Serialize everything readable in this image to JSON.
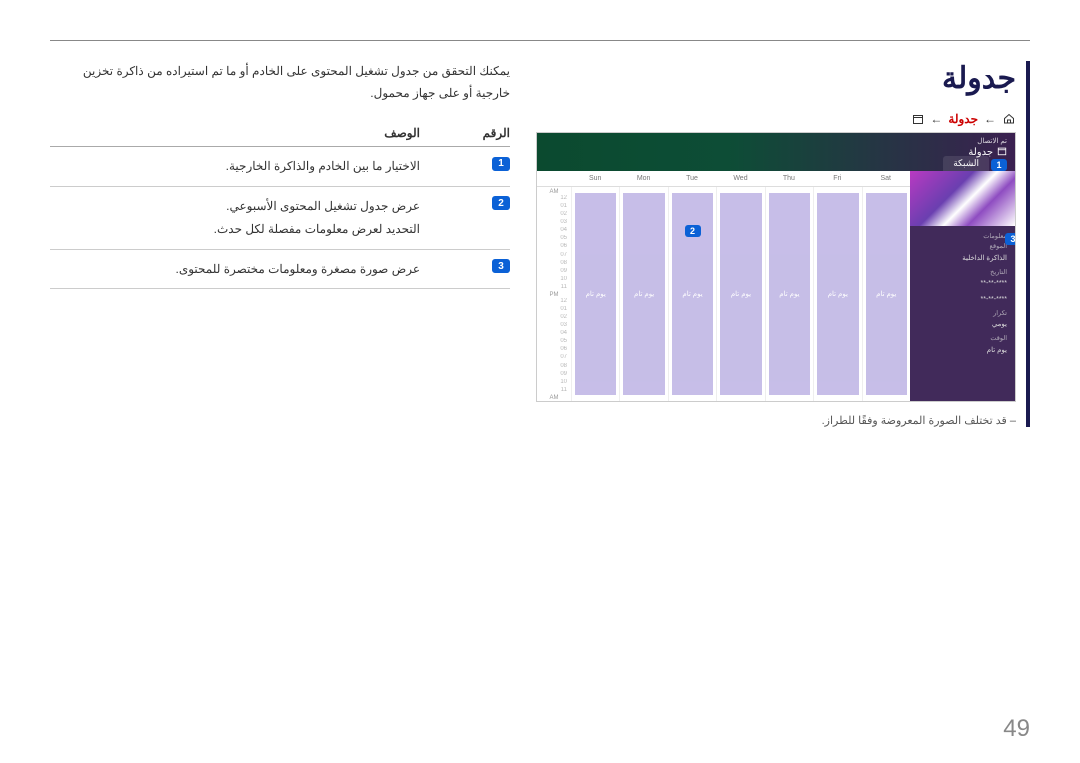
{
  "page_number": "49",
  "title": "جدولة",
  "breadcrumb": {
    "step_schedule": "جدولة"
  },
  "intro": "يمكنك التحقق من جدول تشغيل المحتوى على الخادم أو ما تم استيراده من ذاكرة تخزين خارجية أو على جهاز محمول.",
  "note": "قد تختلف الصورة المعروضة وفقًا للطراز.",
  "table": {
    "head_num": "الرقم",
    "head_desc": "الوصف",
    "rows": [
      {
        "n": "1",
        "desc": "الاختيار ما بين الخادم والذاكرة الخارجية."
      },
      {
        "n": "2",
        "desc": "عرض جدول تشغيل المحتوى الأسبوعي.\nالتحديد لعرض معلومات مفصلة لكل حدث."
      },
      {
        "n": "3",
        "desc": "عرض صورة مصغرة ومعلومات مختصرة للمحتوى."
      }
    ]
  },
  "shot": {
    "connected": "تم الاتصال",
    "title": "جدولة",
    "tab_network": "الشبكة",
    "days": [
      "Sun",
      "Mon",
      "Tue",
      "Wed",
      "Thu",
      "Fri",
      "Sat"
    ],
    "am": "AM",
    "pm": "PM",
    "hours_top": [
      "12",
      "01",
      "02",
      "03",
      "04",
      "05",
      "06",
      "07",
      "08",
      "09",
      "10",
      "11"
    ],
    "event_label": "يوم تام",
    "info": {
      "section": "معلومات",
      "loc_label": "الموقع",
      "loc_val": "الذاكرة الداخلية",
      "date_label": "التاريخ",
      "date_val1": "****-**-**",
      "date_val2": "****-**-**",
      "repeat_label": "تكرار",
      "repeat_val": "يومي",
      "time_label": "الوقت",
      "time_val": "يوم تام"
    }
  }
}
